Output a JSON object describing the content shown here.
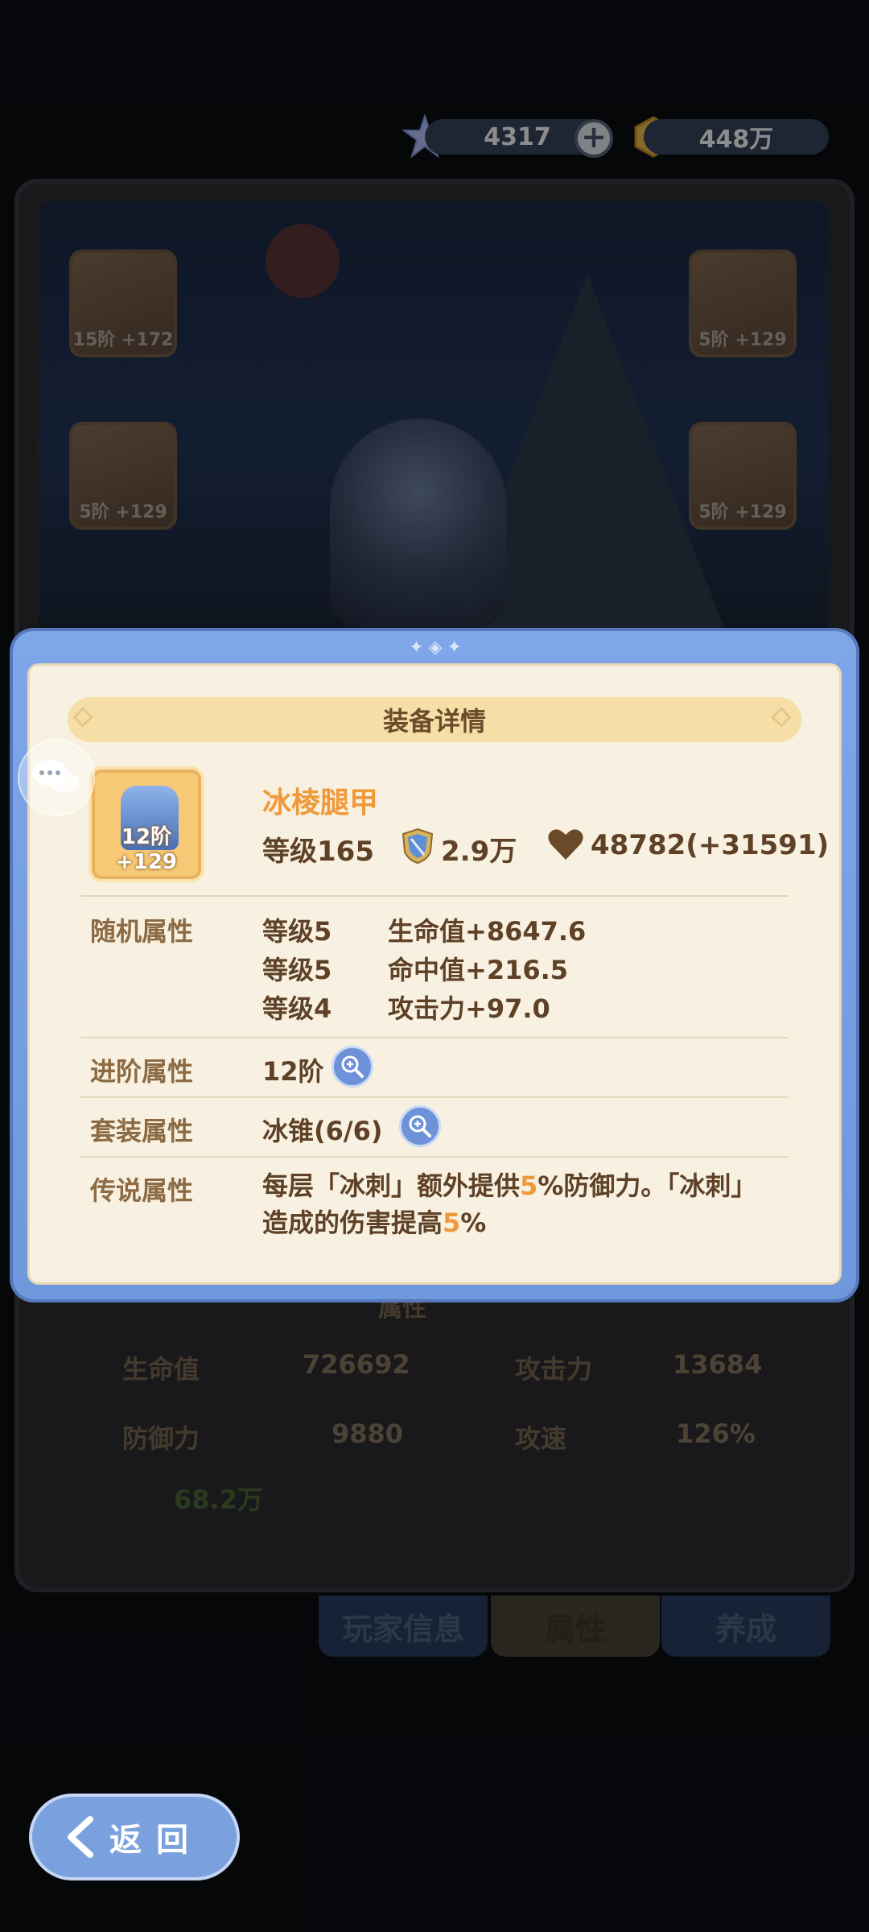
{
  "currency": {
    "gem_value": "4317",
    "coin_value": "448万",
    "plus_label": "+"
  },
  "equip_slots": [
    {
      "label": "15阶 +172"
    },
    {
      "label": "5阶 +129"
    },
    {
      "label": "5阶 +129"
    },
    {
      "label": "5阶 +129"
    }
  ],
  "background_stats": {
    "section_label": "属性",
    "hp_label": "生命值",
    "hp_value": "726692",
    "atk_label": "攻击力",
    "atk_value": "13684",
    "def_label": "防御力",
    "def_value": "9880",
    "spd_label": "攻速",
    "spd_value": "126%",
    "power_value": "68.2万"
  },
  "tabs": [
    {
      "label": "玩家信息"
    },
    {
      "label": "属性"
    },
    {
      "label": "养成"
    }
  ],
  "modal": {
    "title": "装备详情",
    "item": {
      "name": "冰棱腿甲",
      "icon_label": "12阶 +129",
      "level": "等级165",
      "power": "2.9万",
      "hp": "48782(+31591)"
    },
    "random_attrs": {
      "label": "随机属性",
      "rows": [
        {
          "level": "等级5",
          "value": "生命值+8647.6"
        },
        {
          "level": "等级5",
          "value": "命中值+216.5"
        },
        {
          "level": "等级4",
          "value": "攻击力+97.0"
        }
      ]
    },
    "advance_attr": {
      "label": "进阶属性",
      "value": "12阶"
    },
    "set_attr": {
      "label": "套装属性",
      "value": "冰锥(6/6)"
    },
    "legend_attr": {
      "label": "传说属性",
      "text_1": "每层「冰刺」额外提供",
      "hl_1": "5",
      "text_2": "%防御力。「冰刺」造成的伤害提高",
      "hl_2": "5",
      "text_3": "%"
    }
  },
  "back_button": {
    "label": "返回"
  },
  "colors": {
    "modal_frame": "#7ea6e8",
    "modal_body": "#f8f1e1",
    "title_banner": "#f5dfa7",
    "highlight_orange": "#f0993a",
    "text_brown": "#5e4126"
  },
  "icons": [
    "gem-icon",
    "coin-icon",
    "plus-icon",
    "shield-power-icon",
    "heart-icon",
    "zoom-icon",
    "chat-icon",
    "back-arrow-icon"
  ]
}
